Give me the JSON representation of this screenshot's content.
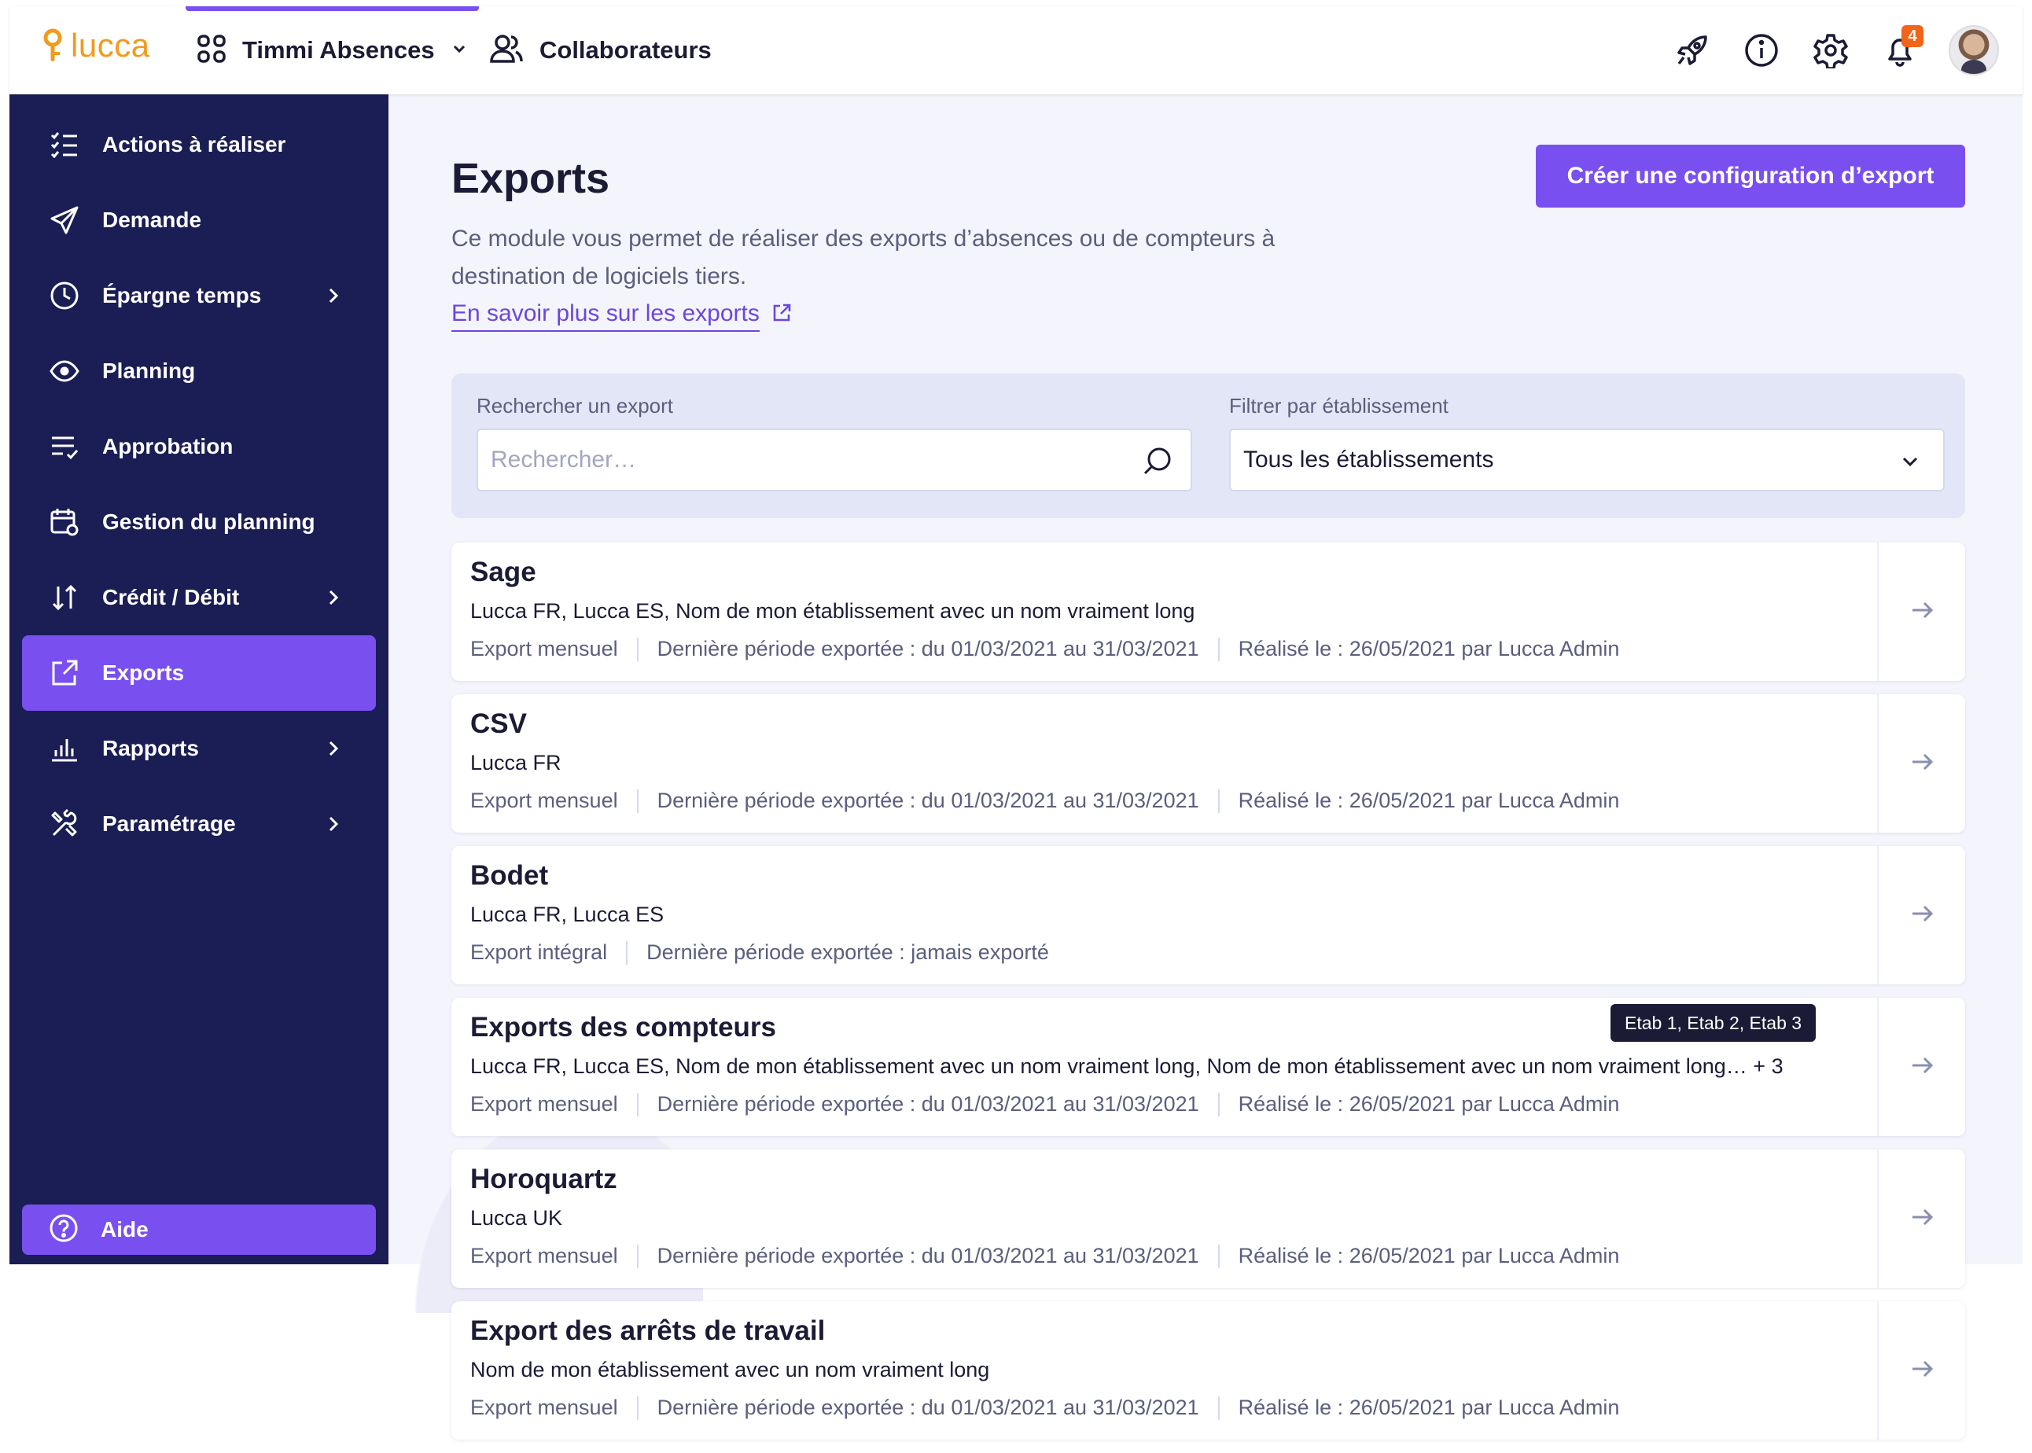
{
  "topbar": {
    "logo_text": "lucca",
    "app_name": "Timmi Absences",
    "collaborators_label": "Collaborateurs",
    "notification_count": "4",
    "icons": [
      "rocket-icon",
      "info-icon",
      "gear-icon",
      "bell-icon"
    ]
  },
  "sidebar": {
    "items": [
      {
        "label": "Actions à réaliser",
        "icon": "checklist-icon",
        "has_submenu": false
      },
      {
        "label": "Demande",
        "icon": "send-icon",
        "has_submenu": false
      },
      {
        "label": "Épargne temps",
        "icon": "clock-icon",
        "has_submenu": true
      },
      {
        "label": "Planning",
        "icon": "eye-icon",
        "has_submenu": false
      },
      {
        "label": "Approbation",
        "icon": "approval-icon",
        "has_submenu": false
      },
      {
        "label": "Gestion du planning",
        "icon": "calendar-gear-icon",
        "has_submenu": false
      },
      {
        "label": "Crédit / Débit",
        "icon": "up-down-arrows-icon",
        "has_submenu": true
      },
      {
        "label": "Exports",
        "icon": "external-link-icon",
        "has_submenu": false,
        "active": true
      },
      {
        "label": "Rapports",
        "icon": "bar-chart-icon",
        "has_submenu": true
      },
      {
        "label": "Paramétrage",
        "icon": "tools-icon",
        "has_submenu": true
      }
    ],
    "help_label": "Aide"
  },
  "main": {
    "title": "Exports",
    "description": "Ce module vous permet de réaliser des exports d’absences ou de compteurs à destination de logiciels tiers.",
    "learn_more": "En savoir plus sur les exports",
    "create_button": "Créer une configuration d’export",
    "search": {
      "label": "Rechercher un export",
      "placeholder": "Rechercher…"
    },
    "filter": {
      "label": "Filtrer par établissement",
      "value": "Tous les établissements"
    },
    "tooltip": "Etab 1, Etab 2, Etab 3",
    "exports": [
      {
        "name": "Sage",
        "establishments": "Lucca FR, Lucca ES, Nom de mon établissement avec un nom vraiment long",
        "more": "",
        "type": "Export mensuel",
        "period": "Dernière période exportée : du 01/03/2021 au 31/03/2021",
        "done": "Réalisé le : 26/05/2021 par Lucca Admin"
      },
      {
        "name": "CSV",
        "establishments": "Lucca FR",
        "more": "",
        "type": "Export mensuel",
        "period": "Dernière période exportée : du 01/03/2021 au 31/03/2021",
        "done": "Réalisé le : 26/05/2021 par Lucca Admin"
      },
      {
        "name": "Bodet",
        "establishments": "Lucca FR, Lucca ES",
        "more": "",
        "type": "Export intégral",
        "period": "Dernière période exportée : jamais exporté",
        "done": ""
      },
      {
        "name": "Exports des compteurs",
        "establishments": "Lucca FR, Lucca ES, Nom de mon établissement avec un nom vraiment long, Nom de mon établissement avec un nom vraiment long…",
        "more": "+ 3",
        "type": "Export mensuel",
        "period": "Dernière période exportée : du 01/03/2021 au 31/03/2021",
        "done": "Réalisé le : 26/05/2021 par Lucca Admin"
      },
      {
        "name": "Horoquartz",
        "establishments": "Lucca UK",
        "more": "",
        "type": "Export mensuel",
        "period": "Dernière période exportée : du 01/03/2021 au 31/03/2021",
        "done": "Réalisé le : 26/05/2021 par Lucca Admin"
      },
      {
        "name": "Export des arrêts de travail",
        "establishments": "Nom de mon établissement avec un nom vraiment long",
        "more": "",
        "type": "Export mensuel",
        "period": "Dernière période exportée : du 01/03/2021 au 31/03/2021",
        "done": "Réalisé le : 26/05/2021 par Lucca Admin"
      }
    ]
  },
  "colors": {
    "sidebar_bg": "#1b1d55",
    "accent": "#7a4ff0",
    "brand_orange": "#f19a1d",
    "badge": "#f26419"
  }
}
